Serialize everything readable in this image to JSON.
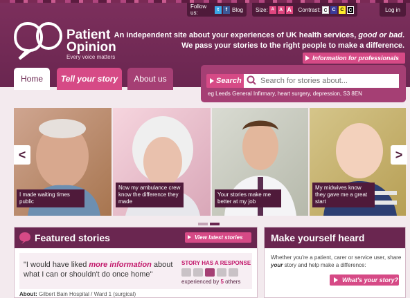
{
  "utility": {
    "follow_label": "Follow us:",
    "twitter_icon": "twitter-icon",
    "facebook_icon": "facebook-icon",
    "blog_label": "Blog",
    "size_label": "Size:",
    "size_options": [
      "A",
      "A",
      "A"
    ],
    "contrast_label": "Contrast:",
    "contrast_options": [
      "C",
      "C",
      "C",
      "C"
    ],
    "login_label": "Log in"
  },
  "brand": {
    "name_line1": "Patient",
    "name_line2": "Opinion",
    "tagline": "Every voice matters"
  },
  "hero": {
    "line1_a": "An independent site about your experiences of UK health services, ",
    "line1_b": "good or bad",
    "line1_c": ".",
    "line2": "We pass your stories to the right people to make a difference.",
    "info_button": "Information for professionals"
  },
  "nav": {
    "home": "Home",
    "tell": "Tell your story",
    "about": "About us"
  },
  "search": {
    "button": "Search",
    "placeholder": "Search for stories about...",
    "example": "eg Leeds General Infirmary, heart surgery, depression, S3 8EN"
  },
  "carousel": {
    "captions": [
      "I made waiting times public",
      "Now my ambulance crew know the difference they made",
      "Your stories make me better at my job",
      "My midwives know they gave me a great start"
    ],
    "left_arrow": "<",
    "right_arrow": ">"
  },
  "featured": {
    "title": "Featured stories",
    "view_latest": "View latest stories",
    "quote_a": "\"I would have liked ",
    "quote_b": "more information",
    "quote_c": " about what I can or shouldn't do once home\"",
    "response_label": "STORY HAS A RESPONSE",
    "experienced_a": "experienced by ",
    "experienced_count": "5",
    "experienced_b": " others",
    "about_label": "About:",
    "about_value": "Gilbert Bain Hospital / Ward 1 (surgical)"
  },
  "heard": {
    "title": "Make yourself heard",
    "text_a": "Whether you're a patient, carer or service user, share ",
    "text_b": "your",
    "text_c": " story and help make a difference:",
    "button": "What's your story?"
  },
  "colors": {
    "brand_purple": "#6a2650",
    "accent_pink": "#d64a86",
    "dark_plum": "#4f1a3a"
  }
}
